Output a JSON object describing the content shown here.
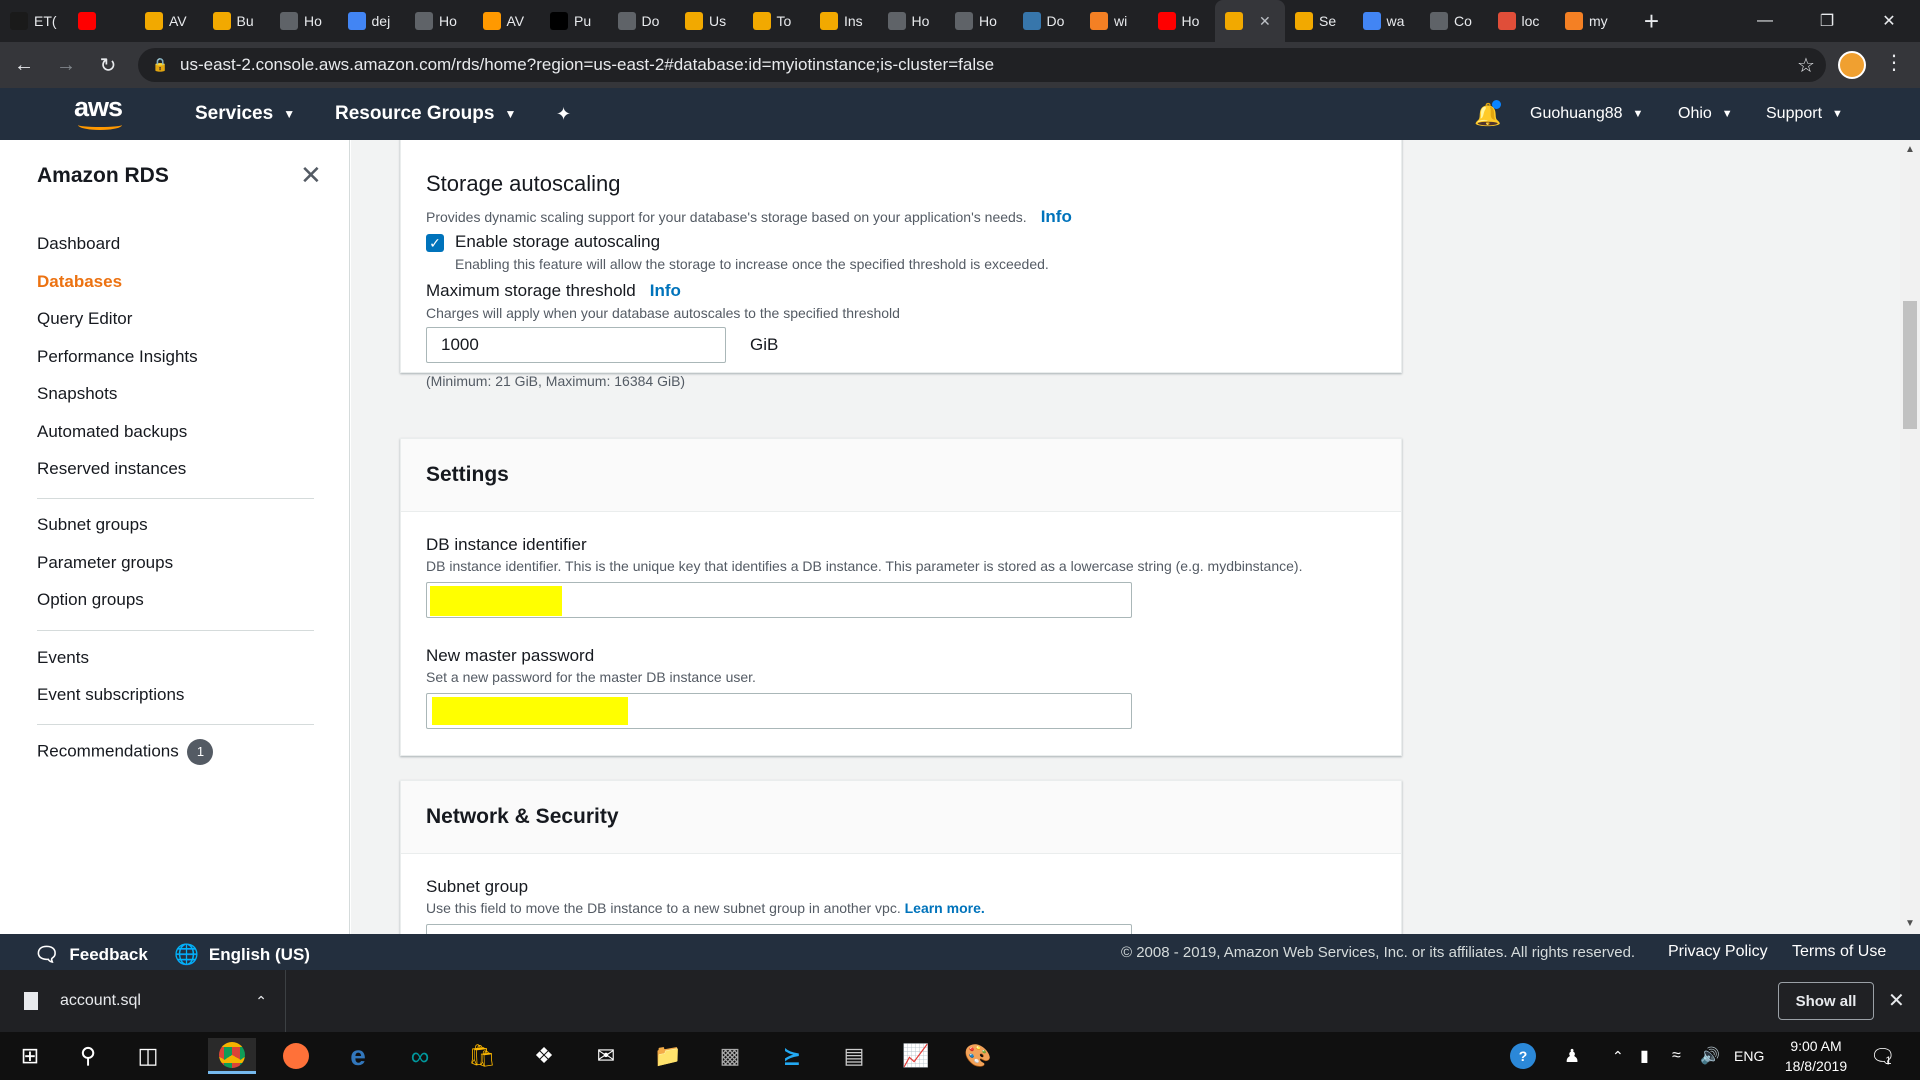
{
  "browser": {
    "tabs": [
      {
        "icon": "bb-icon",
        "label": "ET(",
        "color": "#1a1a1a"
      },
      {
        "icon": "youtube-icon",
        "label": "",
        "color": "#ff0000"
      },
      {
        "icon": "aws-box-icon",
        "label": "AV",
        "color": "#f2a900"
      },
      {
        "icon": "aws-box-icon",
        "label": "Bu",
        "color": "#f2a900"
      },
      {
        "icon": "globe-icon",
        "label": "Ho",
        "color": "#5f6368"
      },
      {
        "icon": "google-icon",
        "label": "dej",
        "color": "#4285f4"
      },
      {
        "icon": "cloud-icon",
        "label": "Ho",
        "color": "#5f6368"
      },
      {
        "icon": "hexagon-icon",
        "label": "AV",
        "color": "#ff9900"
      },
      {
        "icon": "amazon-icon",
        "label": "Pu",
        "color": "#000000"
      },
      {
        "icon": "download-icon",
        "label": "Do",
        "color": "#5f6368"
      },
      {
        "icon": "aws-box-icon",
        "label": "Us",
        "color": "#f2a900"
      },
      {
        "icon": "aws-box-icon",
        "label": "To",
        "color": "#f2a900"
      },
      {
        "icon": "aws-box-icon",
        "label": "Ins",
        "color": "#f2a900"
      },
      {
        "icon": "drop-icon",
        "label": "Ho",
        "color": "#5f6368"
      },
      {
        "icon": "drop-icon",
        "label": "Ho",
        "color": "#5f6368"
      },
      {
        "icon": "python-icon",
        "label": "Do",
        "color": "#3776ab"
      },
      {
        "icon": "stack-icon",
        "label": "wi",
        "color": "#f48024"
      },
      {
        "icon": "youtube-icon",
        "label": "Ho",
        "color": "#ff0000"
      },
      {
        "icon": "aws-box-icon",
        "label": "",
        "color": "#f2a900",
        "active": true
      },
      {
        "icon": "aws-box-icon",
        "label": "Se",
        "color": "#f2a900"
      },
      {
        "icon": "google-icon",
        "label": "wa",
        "color": "#4285f4"
      },
      {
        "icon": "chrome-icon",
        "label": "Co",
        "color": "#5f6368"
      },
      {
        "icon": "mountain-icon",
        "label": "loc",
        "color": "#e04e39"
      },
      {
        "icon": "stack-icon",
        "label": "my",
        "color": "#f48024"
      }
    ],
    "url": "us-east-2.console.aws.amazon.com/rds/home?region=us-east-2#database:id=myiotinstance;is-cluster=false"
  },
  "aws_header": {
    "logo": "aws",
    "services": "Services",
    "resource_groups": "Resource Groups",
    "user": "Guohuang88",
    "region": "Ohio",
    "support": "Support"
  },
  "sidebar": {
    "title": "Amazon RDS",
    "items": [
      {
        "label": "Dashboard"
      },
      {
        "label": "Databases",
        "active": true
      },
      {
        "label": "Query Editor"
      },
      {
        "label": "Performance Insights"
      },
      {
        "label": "Snapshots"
      },
      {
        "label": "Automated backups"
      },
      {
        "label": "Reserved instances"
      },
      {
        "label": "Subnet groups"
      },
      {
        "label": "Parameter groups"
      },
      {
        "label": "Option groups"
      },
      {
        "label": "Events"
      },
      {
        "label": "Event subscriptions"
      },
      {
        "label": "Recommendations",
        "badge": "1"
      }
    ]
  },
  "storage": {
    "title": "Storage autoscaling",
    "description": "Provides dynamic scaling support for your database's storage based on your application's needs.",
    "info": "Info",
    "enable_label": "Enable storage autoscaling",
    "enable_checked": true,
    "enable_desc": "Enabling this feature will allow the storage to increase once the specified threshold is exceeded.",
    "max_label": "Maximum storage threshold",
    "max_desc": "Charges will apply when your database autoscales to the specified threshold",
    "max_value": "1000",
    "unit": "GiB",
    "constraint": "(Minimum: 21 GiB, Maximum: 16384 GiB)"
  },
  "settings": {
    "title": "Settings",
    "db_id_label": "DB instance identifier",
    "db_id_desc": "DB instance identifier. This is the unique key that identifies a DB instance. This parameter is stored as a lowercase string (e.g. mydbinstance).",
    "password_label": "New master password",
    "password_desc": "Set a new password for the master DB instance user."
  },
  "network": {
    "title": "Network & Security",
    "subnet_label": "Subnet group",
    "subnet_desc": "Use this field to move the DB instance to a new subnet group in another vpc.",
    "learn_more": "Learn more."
  },
  "footer": {
    "feedback": "Feedback",
    "language": "English (US)",
    "copyright": "© 2008 - 2019, Amazon Web Services, Inc. or its affiliates. All rights reserved.",
    "privacy": "Privacy Policy",
    "terms": "Terms of Use"
  },
  "downloads": {
    "file": "account.sql",
    "show_all": "Show all"
  },
  "taskbar": {
    "time": "9:00 AM",
    "date": "18/8/2019",
    "lang": "ENG",
    "notifications": "1"
  },
  "colors": {
    "aws_dark": "#232f3e",
    "aws_orange": "#ec7211",
    "link_blue": "#0073bb",
    "redaction": "#ffff00"
  }
}
